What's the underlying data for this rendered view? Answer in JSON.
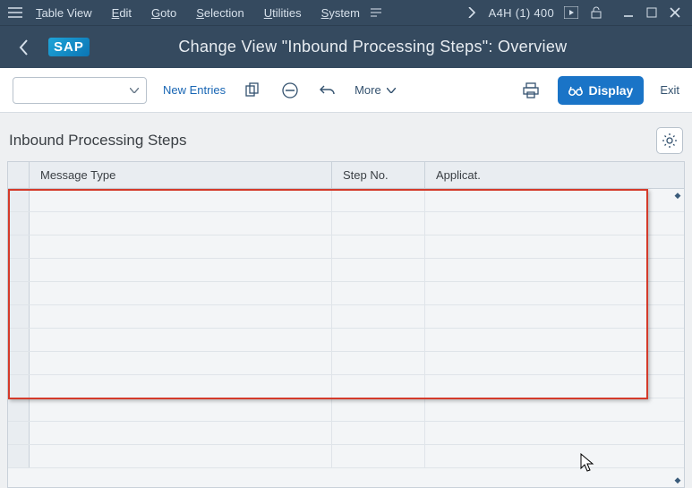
{
  "menubar": {
    "items": [
      {
        "label": "Table View",
        "u": "T",
        "rest": "able View"
      },
      {
        "label": "Edit",
        "u": "E",
        "rest": "dit"
      },
      {
        "label": "Goto",
        "u": "G",
        "rest": "oto"
      },
      {
        "label": "Selection",
        "u": "S",
        "rest": "election"
      },
      {
        "label": "Utilities",
        "u": "U",
        "rest": "tilities"
      },
      {
        "label": "System",
        "u": "S",
        "rest": "ystem"
      }
    ],
    "system_id": "A4H (1) 400"
  },
  "title": "Change View \"Inbound Processing Steps\": Overview",
  "logo_text": "SAP",
  "toolbar": {
    "new_entries": "New Entries",
    "more": "More",
    "display": "Display",
    "exit": "Exit"
  },
  "section_title": "Inbound Processing Steps",
  "columns": {
    "c1": "Message Type",
    "c2": "Step No.",
    "c3": "Applicat."
  },
  "rows": 12
}
